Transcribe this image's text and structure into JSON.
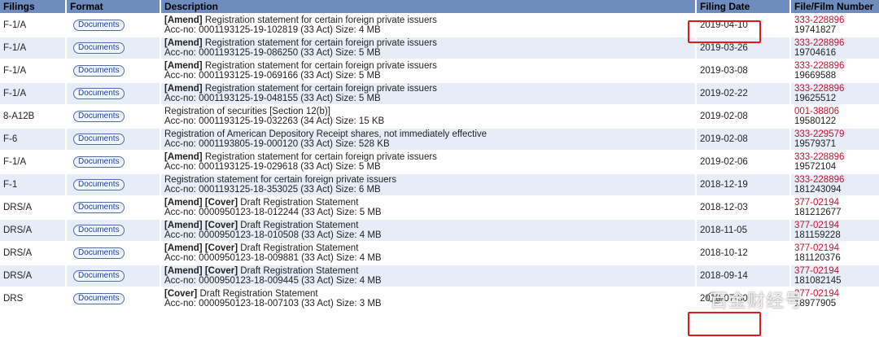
{
  "headers": {
    "filings": "Filings",
    "format": "Format",
    "description": "Description",
    "filing_date": "Filing Date",
    "file_film": "File/Film Number"
  },
  "doc_button_label": "Documents",
  "rows": [
    {
      "filing": "F-1/A",
      "tag": "[Amend]",
      "desc": "Registration statement for certain foreign private issuers",
      "acc": "Acc-no: 0001193125-19-102819 (33 Act)  Size: 4 MB",
      "date": "2019-04-10",
      "file": "333-228896",
      "film": "19741827"
    },
    {
      "filing": "F-1/A",
      "tag": "[Amend]",
      "desc": "Registration statement for certain foreign private issuers",
      "acc": "Acc-no: 0001193125-19-086250 (33 Act)  Size: 5 MB",
      "date": "2019-03-26",
      "file": "333-228896",
      "film": "19704616"
    },
    {
      "filing": "F-1/A",
      "tag": "[Amend]",
      "desc": "Registration statement for certain foreign private issuers",
      "acc": "Acc-no: 0001193125-19-069166 (33 Act)  Size: 5 MB",
      "date": "2019-03-08",
      "file": "333-228896",
      "film": "19669588"
    },
    {
      "filing": "F-1/A",
      "tag": "[Amend]",
      "desc": "Registration statement for certain foreign private issuers",
      "acc": "Acc-no: 0001193125-19-048155 (33 Act)  Size: 5 MB",
      "date": "2019-02-22",
      "file": "333-228896",
      "film": "19625512"
    },
    {
      "filing": "8-A12B",
      "tag": "",
      "desc": "Registration of securities [Section 12(b)]",
      "acc": "Acc-no: 0001193125-19-032263 (34 Act)  Size: 15 KB",
      "date": "2019-02-08",
      "file": "001-38806",
      "film": "19580122"
    },
    {
      "filing": "F-6",
      "tag": "",
      "desc": "Registration of American Depository Receipt shares, not immediately effective",
      "acc": "Acc-no: 0001193805-19-000120 (33 Act)  Size: 528 KB",
      "date": "2019-02-08",
      "file": "333-229579",
      "film": "19579371"
    },
    {
      "filing": "F-1/A",
      "tag": "[Amend]",
      "desc": "Registration statement for certain foreign private issuers",
      "acc": "Acc-no: 0001193125-19-029618 (33 Act)  Size: 5 MB",
      "date": "2019-02-06",
      "file": "333-228896",
      "film": "19572104"
    },
    {
      "filing": "F-1",
      "tag": "",
      "desc": "Registration statement for certain foreign private issuers",
      "acc": "Acc-no: 0001193125-18-353025 (33 Act)  Size: 6 MB",
      "date": "2018-12-19",
      "file": "333-228896",
      "film": "181243094"
    },
    {
      "filing": "DRS/A",
      "tag": "[Amend] [Cover]",
      "desc": "Draft Registration Statement",
      "acc": "Acc-no: 0000950123-18-012244 (33 Act)  Size: 5 MB",
      "date": "2018-12-03",
      "file": "377-02194",
      "film": "181212677"
    },
    {
      "filing": "DRS/A",
      "tag": "[Amend] [Cover]",
      "desc": "Draft Registration Statement",
      "acc": "Acc-no: 0000950123-18-010508 (33 Act)  Size: 4 MB",
      "date": "2018-11-05",
      "file": "377-02194",
      "film": "181159228"
    },
    {
      "filing": "DRS/A",
      "tag": "[Amend] [Cover]",
      "desc": "Draft Registration Statement",
      "acc": "Acc-no: 0000950123-18-009881 (33 Act)  Size: 4 MB",
      "date": "2018-10-12",
      "file": "377-02194",
      "film": "181120376"
    },
    {
      "filing": "DRS/A",
      "tag": "[Amend] [Cover]",
      "desc": "Draft Registration Statement",
      "acc": "Acc-no: 0000950123-18-009445 (33 Act)  Size: 4 MB",
      "date": "2018-09-14",
      "file": "377-02194",
      "film": "181082145"
    },
    {
      "filing": "DRS",
      "tag": "[Cover]",
      "desc": "Draft Registration Statement",
      "acc": "Acc-no: 0000950123-18-007103 (33 Act)  Size: 3 MB",
      "date": "2018-07-30",
      "file": "377-02194",
      "film": "18977905"
    }
  ],
  "watermark": "百金财经号",
  "colors": {
    "header_bg": "#6f8cbf",
    "alt_row": "#e7edf7",
    "link_red": "#c8102e",
    "highlight": "#e0191b"
  }
}
